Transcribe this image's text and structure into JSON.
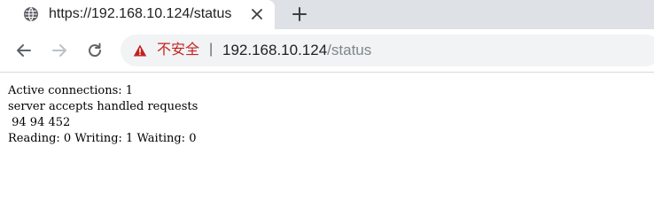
{
  "tab": {
    "title": "https://192.168.10.124/status",
    "favicon": "globe-icon",
    "close_icon": "close-icon"
  },
  "new_tab_icon": "plus-icon",
  "toolbar": {
    "back_icon": "arrow-left-icon",
    "forward_icon": "arrow-right-icon",
    "reload_icon": "reload-icon"
  },
  "omnibox": {
    "security_icon": "warning-triangle-icon",
    "security_label": "不安全",
    "separator": "|",
    "url_host": "192.168.10.124",
    "url_path": "/status"
  },
  "page": {
    "lines": [
      "Active connections: 1",
      "server accepts handled requests",
      " 94 94 452",
      "Reading: 0 Writing: 1 Waiting: 0"
    ]
  },
  "colors": {
    "tab_strip": "#dee1e6",
    "security_warning": "#c5221f",
    "omnibox_bg": "#f1f3f4"
  }
}
